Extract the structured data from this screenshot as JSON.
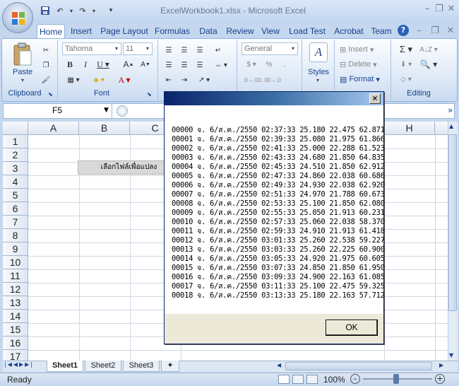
{
  "window": {
    "title": "ExcelWorkbook1.xlsx - Microsoft Excel"
  },
  "tabs": [
    "Home",
    "Insert",
    "Page Layout",
    "Formulas",
    "Data",
    "Review",
    "View",
    "Load Test",
    "Acrobat",
    "Team"
  ],
  "ribbon": {
    "clipboard": {
      "label": "Clipboard",
      "paste": "Paste"
    },
    "font": {
      "label": "Font",
      "name": "Tahoma",
      "size": "11"
    },
    "number": {
      "format": "General"
    },
    "styles": {
      "label": "Styles"
    },
    "cells": {
      "insert": "Insert",
      "delete": "Delete",
      "format": "Format"
    },
    "editing": {
      "label": "Editing"
    }
  },
  "formula_bar": {
    "name_box": "F5"
  },
  "grid": {
    "columns": [
      "A",
      "B",
      "C",
      "H"
    ],
    "rows": [
      "1",
      "2",
      "3",
      "4",
      "5",
      "6",
      "7",
      "8",
      "9",
      "10",
      "11",
      "12",
      "13",
      "14",
      "15",
      "16",
      "17"
    ],
    "button_text": "เลือกไฟล์เพื่อแปลง"
  },
  "sheets": [
    "Sheet1",
    "Sheet2",
    "Sheet3"
  ],
  "status": {
    "ready": "Ready",
    "zoom": "100%"
  },
  "dialog": {
    "lines": [
      "00000 จ. 6/ส.ค./2550 02:37:33 25.180 22.475 62.871",
      "00001 จ. 6/ส.ค./2550 02:39:33 25.080 21.975 61.866",
      "00002 จ. 6/ส.ค./2550 02:41:33 25.000 22.288 61.523",
      "00003 จ. 6/ส.ค./2550 02:43:33 24.680 21.850 64.835",
      "00004 จ. 6/ส.ค./2550 02:45:33 24.510 21.850 62.912",
      "00005 จ. 6/ส.ค./2550 02:47:33 24.860 22.038 60.686",
      "00006 จ. 6/ส.ค./2550 02:49:33 24.930 22.038 62.920",
      "00007 จ. 6/ส.ค./2550 02:51:33 24.970 21.788 60.673",
      "00008 จ. 6/ส.ค./2550 02:53:33 25.100 21.850 62.080",
      "00009 จ. 6/ส.ค./2550 02:55:33 25.050 21.913 60.231",
      "00010 จ. 6/ส.ค./2550 02:57:33 25.060 22.038 58.370",
      "00011 จ. 6/ส.ค./2550 02:59:33 24.910 21.913 61.418",
      "00012 จ. 6/ส.ค./2550 03:01:33 25.260 22.538 59.227",
      "00013 จ. 6/ส.ค./2550 03:03:33 25.260 22.225 60.900",
      "00014 จ. 6/ส.ค./2550 03:05:33 24.920 21.975 60.605",
      "00015 จ. 6/ส.ค./2550 03:07:33 24.850 21.850 61.950",
      "00016 จ. 6/ส.ค./2550 03:09:33 24.900 22.163 61.085",
      "00017 จ. 6/ส.ค./2550 03:11:33 25.100 22.475 59.325",
      "00018 จ. 6/ส.ค./2550 03:13:33 25.180 22.163 57.712"
    ],
    "ok": "OK",
    "close": "×"
  }
}
